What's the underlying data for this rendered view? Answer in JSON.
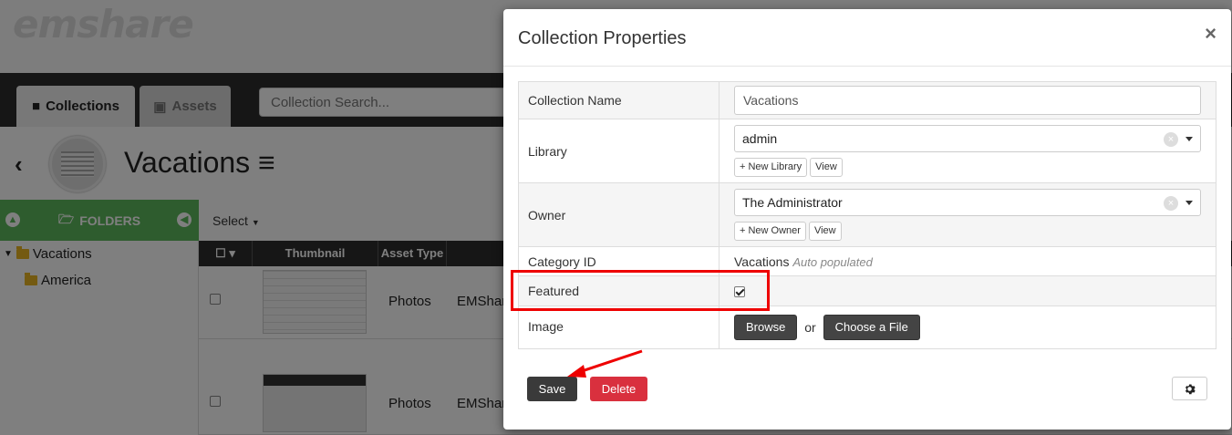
{
  "app": {
    "logo_text": "emshare",
    "nav": {
      "tab_collections": "Collections",
      "tab_assets": "Assets",
      "search_placeholder": "Collection Search..."
    },
    "collection_title": "Vacations",
    "folders_header": "FOLDERS",
    "select_label": "Select",
    "tree": [
      {
        "label": "Vacations"
      },
      {
        "label": "America"
      }
    ],
    "grid": {
      "headers": [
        "Thumbnail",
        "Asset Type"
      ],
      "rows": [
        {
          "type": "Photos",
          "owner": "EMShare"
        },
        {
          "type": "Photos",
          "owner": "EMShare"
        }
      ]
    }
  },
  "modal": {
    "title": "Collection Properties",
    "close_glyph": "×",
    "fields": {
      "collection_name": {
        "label": "Collection Name",
        "value": "Vacations"
      },
      "library": {
        "label": "Library",
        "value": "admin",
        "new_btn": "+ New Library",
        "view_btn": "View"
      },
      "owner": {
        "label": "Owner",
        "value": "The Administrator",
        "new_btn": "+ New Owner",
        "view_btn": "View"
      },
      "category": {
        "label": "Category ID",
        "value": "Vacations",
        "note": "Auto populated"
      },
      "featured": {
        "label": "Featured",
        "checked": true
      },
      "image": {
        "label": "Image",
        "browse_btn": "Browse",
        "or_text": "or",
        "choose_btn": "Choose a File"
      }
    },
    "save_label": "Save",
    "delete_label": "Delete"
  },
  "colors": {
    "highlight": "#e00000",
    "delete": "#d9303e",
    "folders_header": "#5cb85c"
  }
}
